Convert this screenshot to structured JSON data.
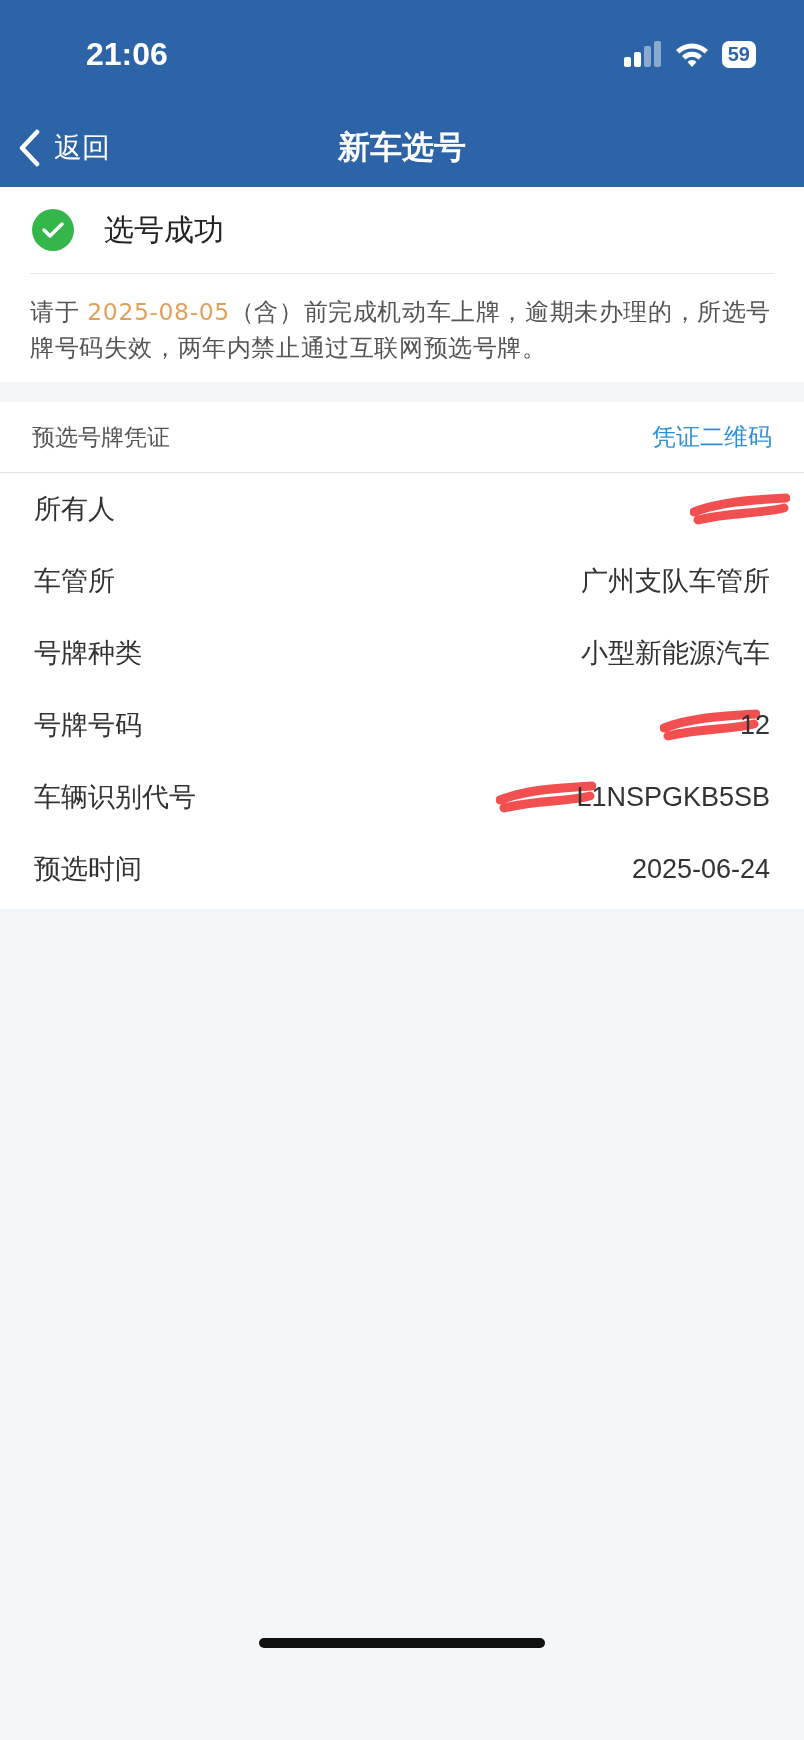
{
  "status_bar": {
    "time": "21:06",
    "battery": "59"
  },
  "nav": {
    "back": "返回",
    "title": "新车选号"
  },
  "result": {
    "title": "选号成功",
    "deadline": "2025-08-05",
    "notice_before": "请于 ",
    "notice_after": "（含）前完成机动车上牌，逾期未办理的，所选号牌号码失效，两年内禁止通过互联网预选号牌。"
  },
  "voucher": {
    "title": "预选号牌凭证",
    "link": "凭证二维码",
    "rows": [
      {
        "label": "所有人",
        "redacted": true
      },
      {
        "label": "车管所",
        "value": "广州支队车管所",
        "redacted": false
      },
      {
        "label": "号牌种类",
        "value": "小型新能源汽车",
        "redacted": false
      },
      {
        "label": "号牌号码",
        "value": "12",
        "redacted": true
      },
      {
        "label": "车辆识别代号",
        "value": "L1NSPGKB5SB",
        "redacted": true
      },
      {
        "label": "预选时间",
        "value": "2025-06-24",
        "redacted": false
      }
    ]
  }
}
